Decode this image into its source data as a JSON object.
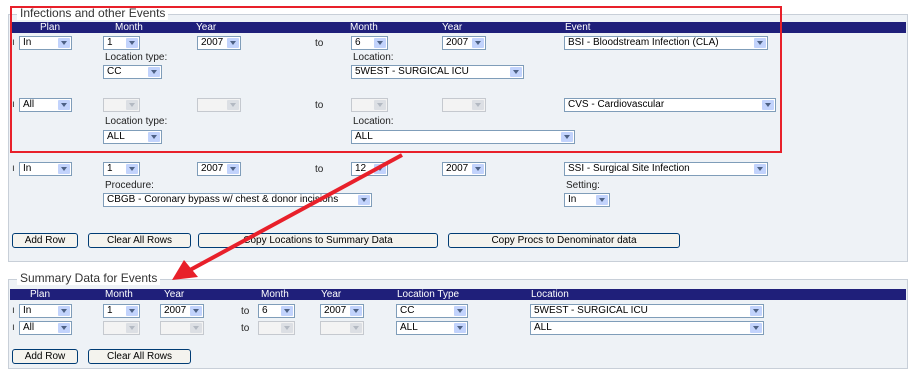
{
  "infections": {
    "legend": "Infections and other Events",
    "headers": {
      "plan": "Plan",
      "month1": "Month",
      "year1": "Year",
      "month2": "Month",
      "year2": "Year",
      "event": "Event"
    },
    "to": "to",
    "rows": [
      {
        "plan": "In",
        "month1": "1",
        "year1": "2007",
        "month2": "6",
        "year2": "2007",
        "event": "BSI - Bloodstream Infection (CLA)",
        "sub_label_left": "Location type:",
        "sub_value_left": "CC",
        "sub_label_right": "Location:",
        "sub_value_right": "5WEST - SURGICAL ICU"
      },
      {
        "plan": "All",
        "month1": "",
        "year1": "",
        "month2": "",
        "year2": "",
        "event": "CVS - Cardiovascular",
        "sub_label_left": "Location type:",
        "sub_value_left": "ALL",
        "sub_label_right": "Location:",
        "sub_value_right": "ALL"
      },
      {
        "plan": "In",
        "month1": "1",
        "year1": "2007",
        "month2": "12",
        "year2": "2007",
        "event": "SSI - Surgical Site Infection",
        "sub_label_left": "Procedure:",
        "sub_value_left": "CBGB - Coronary bypass w/ chest & donor incisions",
        "sub_label_right": "Setting:",
        "sub_value_right": "In"
      }
    ],
    "buttons": {
      "add_row": "Add Row",
      "clear_all": "Clear All Rows",
      "copy_locations": "Copy Locations to Summary Data",
      "copy_procs": "Copy Procs to Denominator data"
    }
  },
  "summary": {
    "legend": "Summary Data for Events",
    "headers": {
      "plan": "Plan",
      "month1": "Month",
      "year1": "Year",
      "month2": "Month",
      "year2": "Year",
      "location_type": "Location Type",
      "location": "Location"
    },
    "to": "to",
    "rows": [
      {
        "plan": "In",
        "month1": "1",
        "year1": "2007",
        "month2": "6",
        "year2": "2007",
        "location_type": "CC",
        "location": "5WEST - SURGICAL ICU"
      },
      {
        "plan": "All",
        "month1": "",
        "year1": "",
        "month2": "",
        "year2": "",
        "location_type": "ALL",
        "location": "ALL"
      }
    ],
    "buttons": {
      "add_row": "Add Row",
      "clear_all": "Clear All Rows"
    }
  },
  "row_marker": "ı",
  "colors": {
    "header_bg": "#1f1f7a",
    "highlight": "#e8202a",
    "section_bg": "#eef2f6"
  }
}
